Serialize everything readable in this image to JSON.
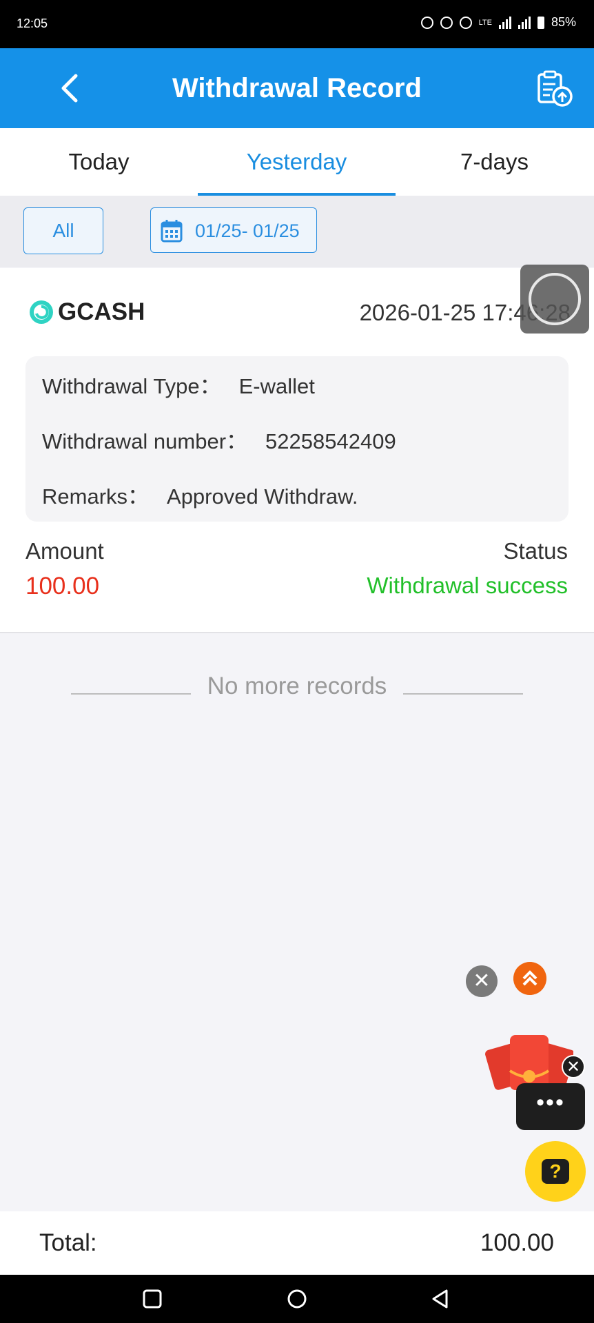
{
  "status_bar": {
    "time": "12:05",
    "battery": "85%",
    "network": "LTE"
  },
  "header": {
    "title": "Withdrawal Record",
    "back_icon": "chevron-left-icon",
    "export_icon": "clipboard-upload-icon"
  },
  "tabs": [
    {
      "label": "Today",
      "active": false
    },
    {
      "label": "Yesterday",
      "active": true
    },
    {
      "label": "7-days",
      "active": false
    }
  ],
  "filters": {
    "all_label": "All",
    "date_range": "01/25- 01/25",
    "calendar_icon": "calendar-icon"
  },
  "record": {
    "channel": "GCASH",
    "datetime": "2026-01-25 17:46:28",
    "type_label": "Withdrawal Type：",
    "type_value": "E-wallet",
    "number_label": "Withdrawal number：",
    "number_value": "52258542409",
    "remarks_label": "Remarks：",
    "remarks_value": "Approved Withdraw.",
    "amount_label": "Amount",
    "amount_value": "100.00",
    "status_label": "Status",
    "status_value": "Withdrawal success"
  },
  "list_end": "No more records",
  "footer": {
    "total_label": "Total:",
    "total_value": "100.00"
  },
  "colors": {
    "primary": "#1591e8",
    "amount": "#e8301c",
    "success": "#22c02a"
  }
}
